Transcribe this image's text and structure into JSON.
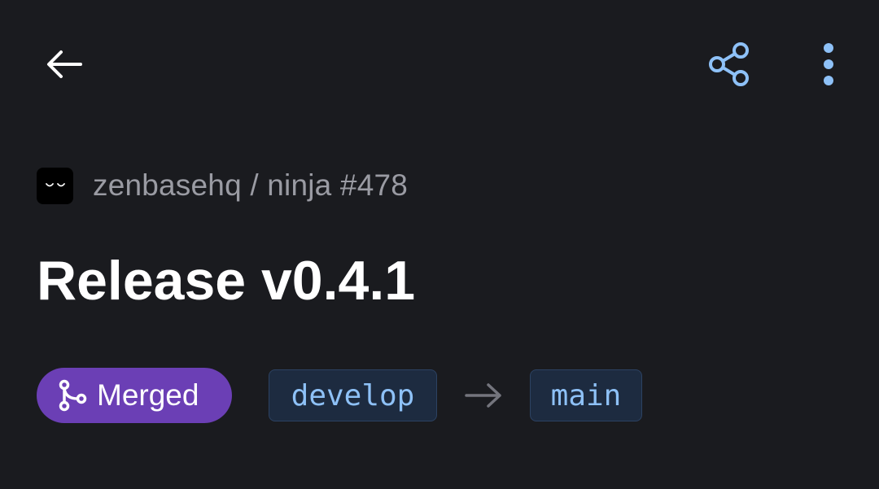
{
  "header": {
    "back_icon": "arrow-left-icon",
    "share_icon": "share-icon",
    "more_icon": "more-vertical-icon"
  },
  "repo": {
    "avatar_icon": "repo-avatar-icon",
    "path": "zenbasehq / ninja #478"
  },
  "pr": {
    "title": "Release v0.4.1",
    "status": "Merged",
    "status_icon": "git-merge-icon",
    "head_branch": "develop",
    "base_branch": "main",
    "arrow_icon": "arrow-right-icon"
  },
  "colors": {
    "background": "#1a1b1f",
    "merged": "#6b3fb5",
    "accent": "#8ec1f7",
    "muted_text": "#9a9ba3"
  }
}
